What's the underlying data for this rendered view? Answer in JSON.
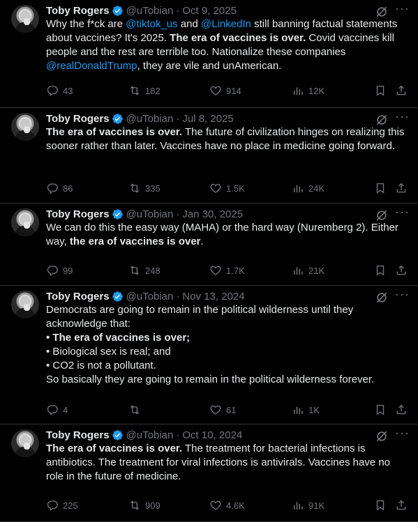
{
  "tweets": [
    {
      "author": "Toby Rogers",
      "handle": "@uTobian",
      "date": "Oct 9, 2025",
      "segments": [
        {
          "t": "Why the f*ck are ",
          "s": "n"
        },
        {
          "t": "@tiktok_us",
          "s": "m"
        },
        {
          "t": " and ",
          "s": "n"
        },
        {
          "t": "@LinkedIn",
          "s": "m"
        },
        {
          "t": " still banning factual statements about vaccines? It's 2025. ",
          "s": "n"
        },
        {
          "t": "The era of vaccines is over.",
          "s": "b"
        },
        {
          "t": " Covid vaccines kill people and the rest are terrible too. Nationalize these companies ",
          "s": "n"
        },
        {
          "t": "@realDonaldTrump",
          "s": "m"
        },
        {
          "t": ", they are vile and unAmerican.",
          "s": "n"
        }
      ],
      "replies": "43",
      "reposts": "182",
      "likes": "914",
      "views": "12K"
    },
    {
      "author": "Toby Rogers",
      "handle": "@uTobian",
      "date": "Jul 8, 2025",
      "segments": [
        {
          "t": "The era of vaccines is over.",
          "s": "b"
        },
        {
          "t": " The future of civilization hinges on realizing this sooner rather than later. Vaccines have no place in medicine going forward.",
          "s": "n"
        }
      ],
      "replies": "86",
      "reposts": "335",
      "likes": "1.5K",
      "views": "24K"
    },
    {
      "author": "Toby Rogers",
      "handle": "@uTobian",
      "date": "Jan 30, 2025",
      "segments": [
        {
          "t": "We can do this the easy way (MAHA) or the hard way (Nuremberg 2). Either way, ",
          "s": "n"
        },
        {
          "t": "the era of vaccines is over",
          "s": "b"
        },
        {
          "t": ".",
          "s": "n"
        }
      ],
      "replies": "99",
      "reposts": "248",
      "likes": "1.7K",
      "views": "21K"
    },
    {
      "author": "Toby Rogers",
      "handle": "@uTobian",
      "date": "Nov 13, 2024",
      "segments": [
        {
          "t": "Democrats are going to remain in the political wilderness until they acknowledge that:",
          "s": "n"
        },
        {
          "t": "",
          "s": "br"
        },
        {
          "t": "• The era of vaccines is over;",
          "s": "b"
        },
        {
          "t": "",
          "s": "br"
        },
        {
          "t": "• Biological sex is real; and",
          "s": "n"
        },
        {
          "t": "",
          "s": "br"
        },
        {
          "t": "• CO2 is not a pollutant.",
          "s": "n"
        },
        {
          "t": "",
          "s": "br"
        },
        {
          "t": "So basically they are going to remain in the political wilderness forever.",
          "s": "n"
        }
      ],
      "replies": "4",
      "reposts": "",
      "likes": "61",
      "views": "1K"
    },
    {
      "author": "Toby Rogers",
      "handle": "@uTobian",
      "date": "Oct 10, 2024",
      "segments": [
        {
          "t": "The era of vaccines is over.",
          "s": "b"
        },
        {
          "t": " The treatment for bacterial infections is antibiotics. The treatment for viral infections is antivirals. Vaccines have no role in the future of medicine.",
          "s": "n"
        }
      ],
      "replies": "225",
      "reposts": "909",
      "likes": "4.6K",
      "views": "91K"
    }
  ],
  "colors": {
    "background": "#000000",
    "text": "#e7e9ea",
    "muted": "#71767b",
    "link": "#1d9bf0",
    "divider": "#2f3336"
  },
  "icons": [
    "verified-badge-icon",
    "grok-icon",
    "more-icon",
    "reply-icon",
    "repost-icon",
    "like-icon",
    "views-icon",
    "bookmark-icon",
    "share-icon"
  ]
}
